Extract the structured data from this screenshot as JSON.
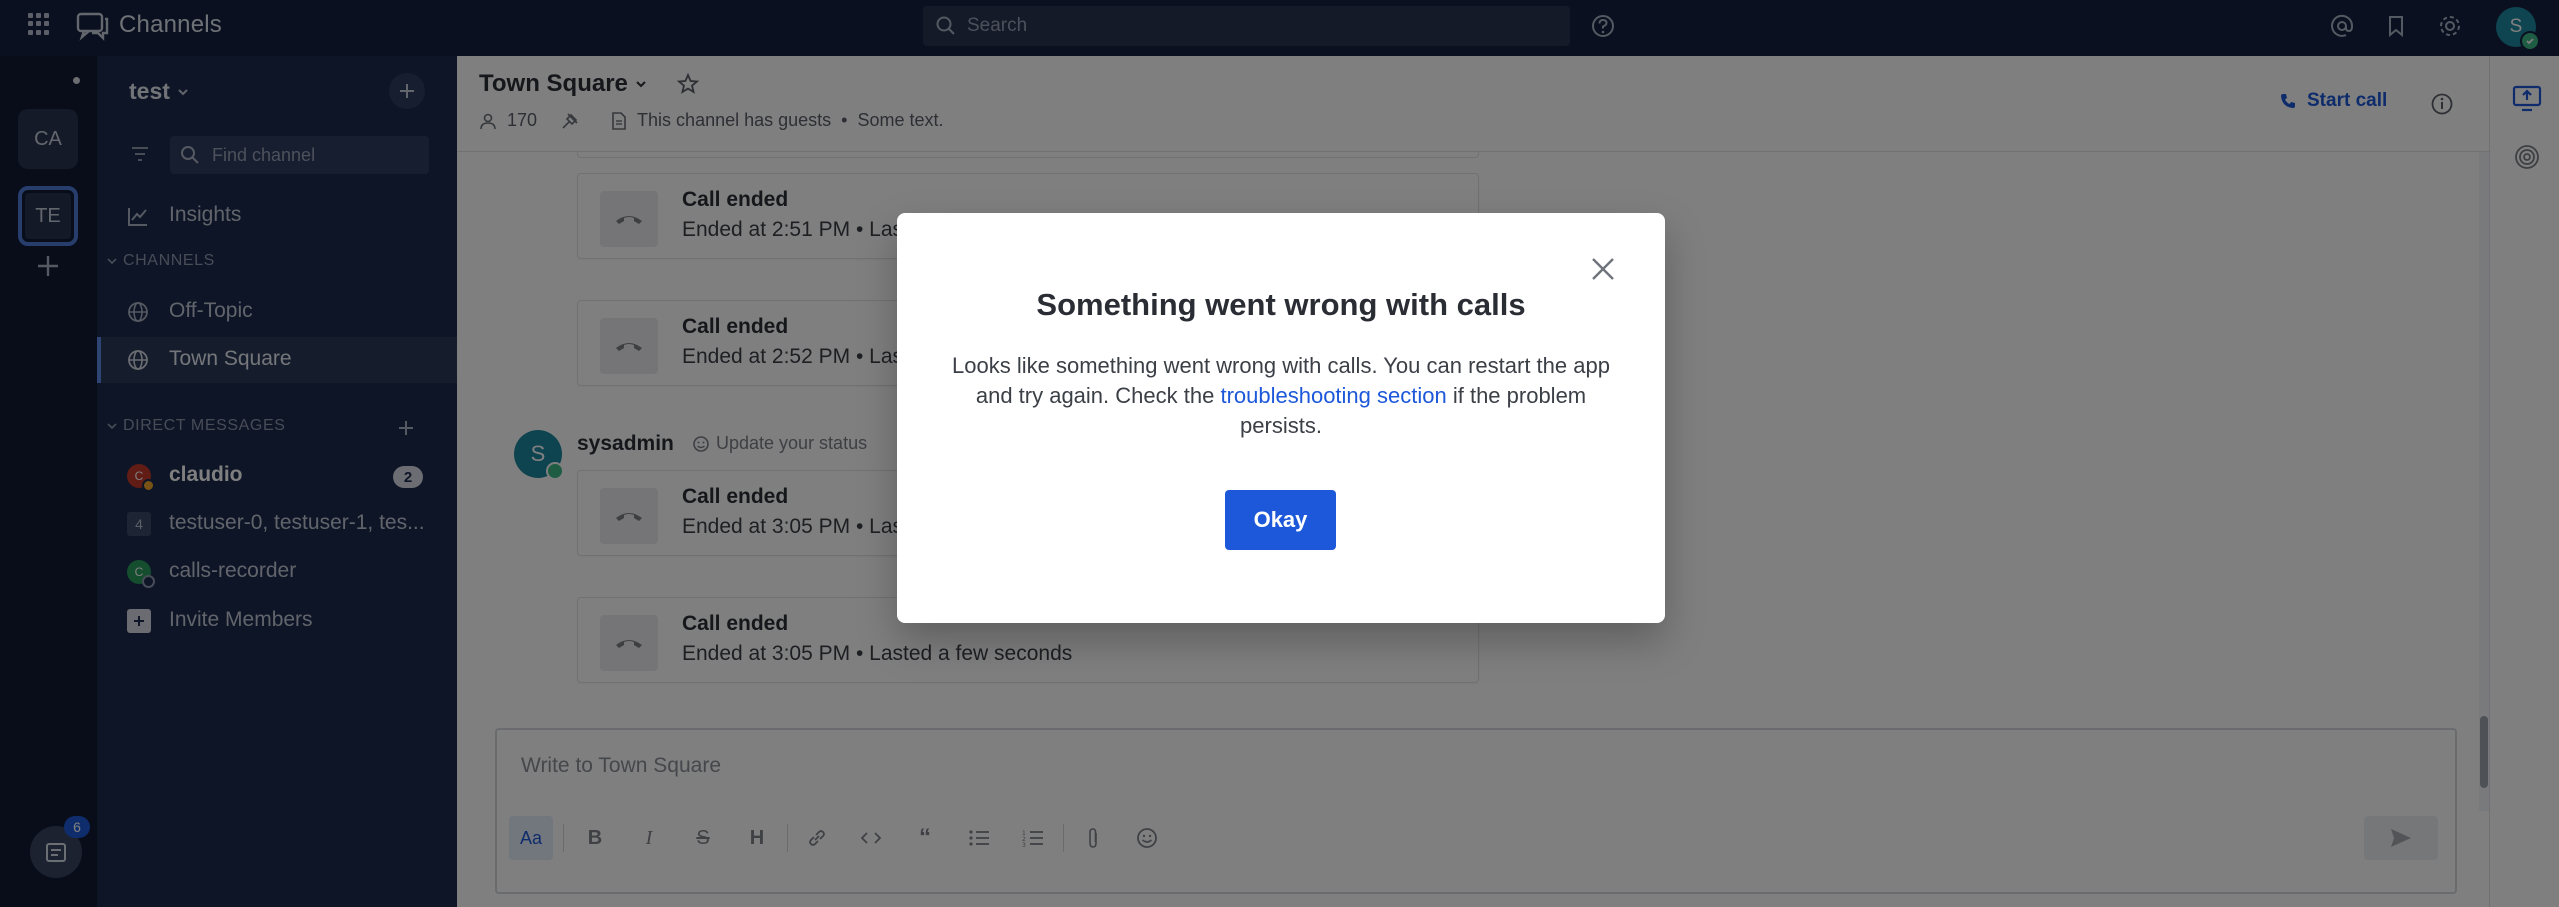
{
  "app": {
    "product_name": "Channels",
    "search_placeholder": "Search",
    "user_initial": "S"
  },
  "teams": [
    {
      "initials": "CA"
    },
    {
      "initials": "TE"
    }
  ],
  "checklist_badge": "6",
  "sidebar": {
    "team_name": "test",
    "find_channel_placeholder": "Find channel",
    "insights": "Insights",
    "channels_header": "CHANNELS",
    "channels": [
      "Off-Topic",
      "Town Square"
    ],
    "dm_header": "DIRECT MESSAGES",
    "dms": [
      {
        "name": "claudio",
        "initial": "C",
        "unread": "2"
      },
      {
        "name": "testuser-0, testuser-1, tes...",
        "group_count": "4"
      },
      {
        "name": "calls-recorder",
        "initial": "C"
      }
    ],
    "invite": "Invite Members"
  },
  "channel": {
    "name": "Town Square",
    "member_count": "170",
    "header_text": "This channel has guests",
    "header_extra": "Some text.",
    "start_call": "Start call",
    "bullet": "•"
  },
  "posts": {
    "calls": [
      {
        "title": "Call ended",
        "detail": "Ended at 2:51 PM • Las"
      },
      {
        "title": "Call ended",
        "detail": "Ended at 2:52 PM • Las"
      },
      {
        "title": "Call ended",
        "detail": "Ended at 3:05 PM • Las"
      },
      {
        "title": "Call ended",
        "detail": "Ended at 3:05 PM • Lasted a few seconds"
      }
    ],
    "user": "sysadmin",
    "user_initial": "S",
    "status_prompt": "Update your status"
  },
  "composer": {
    "placeholder": "Write to Town Square",
    "aa": "Aa"
  },
  "modal": {
    "title": "Something went wrong with calls",
    "body_before": "Looks like something went wrong with calls. You can restart the app and try again. Check the",
    "link": "troubleshooting section",
    "body_after": "if the problem persists.",
    "ok": "Okay"
  },
  "colors": {
    "topbar": "#14213e",
    "sidebar": "#1b2a4d",
    "accent": "#1c58d9",
    "online": "#3db887"
  }
}
